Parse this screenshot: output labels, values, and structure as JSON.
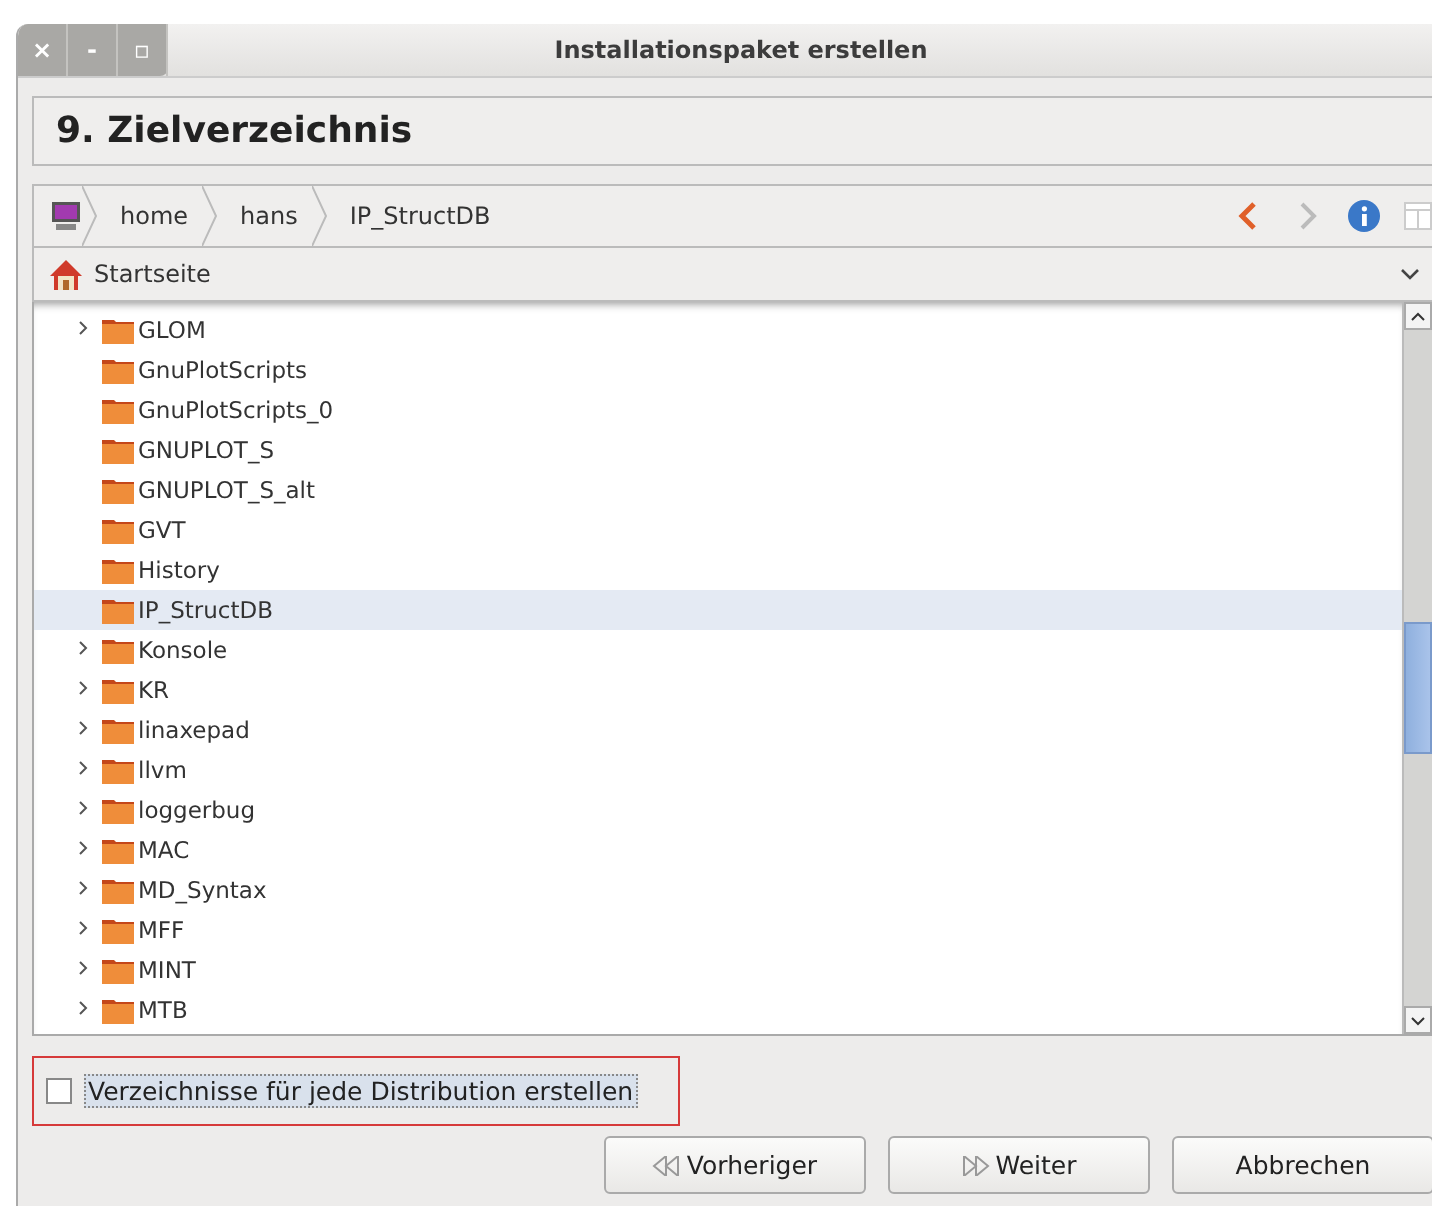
{
  "window": {
    "title": "Installationspaket erstellen",
    "controls": [
      "×",
      "-",
      "▫"
    ]
  },
  "step_heading": "9. Zielverzeichnis",
  "breadcrumb": {
    "segments": [
      "home",
      "hans",
      "IP_StructDB"
    ]
  },
  "places": {
    "label": "Startseite"
  },
  "tree": {
    "items": [
      {
        "name": "GLOM",
        "has_children": true,
        "selected": false
      },
      {
        "name": "GnuPlotScripts",
        "has_children": false,
        "selected": false
      },
      {
        "name": "GnuPlotScripts_0",
        "has_children": false,
        "selected": false
      },
      {
        "name": "GNUPLOT_S",
        "has_children": false,
        "selected": false
      },
      {
        "name": "GNUPLOT_S_alt",
        "has_children": false,
        "selected": false
      },
      {
        "name": "GVT",
        "has_children": false,
        "selected": false
      },
      {
        "name": "History",
        "has_children": false,
        "selected": false
      },
      {
        "name": "IP_StructDB",
        "has_children": false,
        "selected": true
      },
      {
        "name": "Konsole",
        "has_children": true,
        "selected": false
      },
      {
        "name": "KR",
        "has_children": true,
        "selected": false
      },
      {
        "name": "linaxepad",
        "has_children": true,
        "selected": false
      },
      {
        "name": "llvm",
        "has_children": true,
        "selected": false
      },
      {
        "name": "loggerbug",
        "has_children": true,
        "selected": false
      },
      {
        "name": "MAC",
        "has_children": true,
        "selected": false
      },
      {
        "name": "MD_Syntax",
        "has_children": true,
        "selected": false
      },
      {
        "name": "MFF",
        "has_children": true,
        "selected": false
      },
      {
        "name": "MINT",
        "has_children": true,
        "selected": false
      },
      {
        "name": "MTB",
        "has_children": true,
        "selected": false
      }
    ]
  },
  "option": {
    "label": "Verzeichnisse für jede Distribution erstellen",
    "checked": false,
    "highlighted": true
  },
  "buttons": [
    {
      "label": "Vorheriger",
      "kind": "back"
    },
    {
      "label": "Weiter",
      "kind": "next"
    },
    {
      "label": "Abbrechen",
      "kind": "plain"
    }
  ]
}
